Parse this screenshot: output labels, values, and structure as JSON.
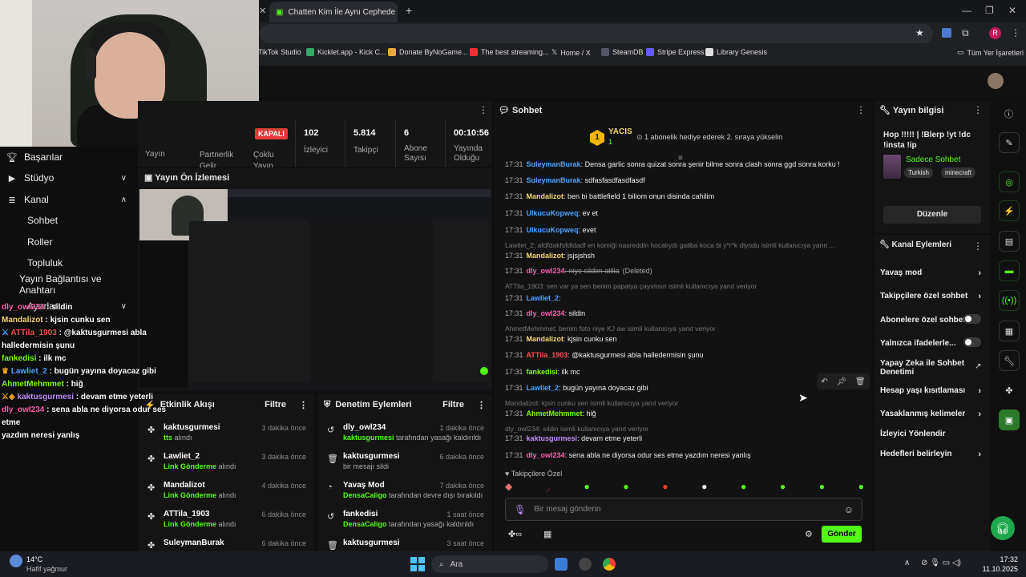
{
  "browser": {
    "tab_title": "Chatten Kim İle Aynı Cephede",
    "bookmarks": [
      "TikTok Studio",
      "Kicklet.app - Kick C...",
      "Donate ByNoGame...",
      "The best streaming...",
      "Home / X",
      "SteamDB",
      "Stripe Express",
      "Library Genesis"
    ],
    "all_bookmarks": "Tüm Yer İşaretleri",
    "profile": "R"
  },
  "sidebar": {
    "items": [
      {
        "label": "Başarılar",
        "icon": "trophy-icon"
      },
      {
        "label": "Stüdyo",
        "icon": "studio-icon",
        "chev": "∨"
      },
      {
        "label": "Kanal",
        "icon": "channel-icon",
        "chev": "∧"
      },
      {
        "label": "Sohbet"
      },
      {
        "label": "Roller"
      },
      {
        "label": "Topluluk"
      },
      {
        "label": "Yayın Bağlantısı ve Anahtarı"
      },
      {
        "label": "Ayarlar",
        "chev": "∨"
      }
    ]
  },
  "overlay_chat": [
    {
      "u": "dly_owl234",
      "c": "#ff5fae",
      "m": "sildin"
    },
    {
      "u": "Mandalizot",
      "c": "#f5d76e",
      "m": "kjsin cunku sen"
    },
    {
      "u": "ATTila_1903",
      "c": "#ff4d4d",
      "m": "@kaktusgurmesi abla",
      "m2": "halledermisin şunu"
    },
    {
      "u": "fankedisi",
      "c": "#7cfc00",
      "m": "ilk mc"
    },
    {
      "u": "Lawliet_2",
      "c": "#4da3ff",
      "m": "bugün yayına doyacaz gibi"
    },
    {
      "u": "AhmetMehmmet",
      "c": "#7cfc00",
      "m": "hiğ"
    },
    {
      "u": "kaktusgurmesi",
      "c": "#c48cff",
      "m": "devam etme yeterli"
    },
    {
      "u": "dly_owl234",
      "c": "#ff5fae",
      "m": "sena abla ne diyorsa odur ses etme",
      "m2": "yazdım neresi yanlış"
    }
  ],
  "stats": {
    "status": "KAPALI",
    "items": [
      {
        "value": "",
        "label": "Yayın"
      },
      {
        "value": "",
        "label": "Partnerlik Gelir"
      },
      {
        "value": "",
        "label": "Çoklu Yayın"
      },
      {
        "value": "102",
        "label": "İzleyici"
      },
      {
        "value": "5.814",
        "label": "Takipçi"
      },
      {
        "value": "6",
        "label": "Abone Sayısı"
      },
      {
        "value": "00:10:56",
        "label": "Yayında Olduğu"
      }
    ]
  },
  "preview": {
    "title": "Yayın Ön İzlemesi"
  },
  "activity": {
    "title": "Etkinlik Akışı",
    "filter": "Filtre",
    "events": [
      {
        "name": "kaktusgurmesi",
        "sub": "tts",
        "sub2": " alındı",
        "time": "3 dakika önce"
      },
      {
        "name": "Lawliet_2",
        "sub": "Link Gönderme",
        "sub2": " alındı",
        "time": "3 dakika önce"
      },
      {
        "name": "Mandalizot",
        "sub": "Link Gönderme",
        "sub2": " alındı",
        "time": "4 dakika önce"
      },
      {
        "name": "ATTila_1903",
        "sub": "Link Gönderme",
        "sub2": " alındı",
        "time": "6 dakika önce"
      },
      {
        "name": "SuleymanBurak",
        "sub": "",
        "sub2": "",
        "time": "6 dakika önce"
      }
    ]
  },
  "moderation": {
    "title": "Denetim Eylemleri",
    "filter": "Filtre",
    "events": [
      {
        "name": "dly_owl234",
        "sub": "kaktusgurmesi",
        "sub2": " tarafından yasağı kaldırıldı",
        "time": "1 dakika önce",
        "icon": "undo-icon"
      },
      {
        "name": "kaktusgurmesi",
        "sub": "",
        "sub2": "bir mesajı sildi",
        "time": "6 dakika önce",
        "icon": "trash-icon"
      },
      {
        "name": "Yavaş Mod",
        "sub": "DensaCaligo",
        "sub2": " tarafından devre dışı bırakıldı",
        "time": "7 dakika önce",
        "icon": "slow-icon"
      },
      {
        "name": "fankedisi",
        "sub": "DensaCaligo",
        "sub2": " tarafından yasağı kaldırıldı",
        "time": "1 saat önce",
        "icon": "undo-icon"
      },
      {
        "name": "kaktusgurmesi",
        "sub": "",
        "sub2": "",
        "time": "3 saat önce",
        "icon": "trash-icon"
      }
    ]
  },
  "chat": {
    "title": "Sohbet",
    "top_gifter": "YACIS",
    "top_gifter_count": "1",
    "gift_msg": "1 abonelik hediye ederek 2. sıraya yükselin",
    "input_placeholder": "Bir mesaj gönderin",
    "send_label": "Gönder",
    "followers_only": "Takipçilere Özel",
    "messages": [
      {
        "type": "msg",
        "t": "17:31",
        "u": "SuleymanBurak",
        "c": "#4da3ff",
        "m": ": Densa garlic sonra quizat sonra şenir bilme sonra clash sonra ggd sonra korku !"
      },
      {
        "type": "msg",
        "t": "17:31",
        "u": "SuleymanBurak",
        "c": "#4da3ff",
        "m": ": sdfasfasdfasdfasdf"
      },
      {
        "type": "msg",
        "t": "17:31",
        "u": "Mandalizot",
        "c": "#f5d76e",
        "m": ": ben bi battlefield 1 biliom onun disinda cahilim"
      },
      {
        "type": "msg",
        "t": "17:31",
        "u": "UlkucuKopweq",
        "c": "#4da3ff",
        "m": ": ev et"
      },
      {
        "type": "msg",
        "t": "17:31",
        "u": "UlkucuKopweq",
        "c": "#4da3ff",
        "m": ": evet"
      },
      {
        "type": "reply",
        "m": "Lawliet_2: afdfdakfsfdldadf en komiği nasreddin hocalıydı galiba koca bi y*r*k diyodu isimli kullanıcıya yanıt ..."
      },
      {
        "type": "msg",
        "t": "17:31",
        "u": "Mandalizot",
        "c": "#f5d76e",
        "m": ": jsjsjshsh"
      },
      {
        "type": "msg",
        "t": "17:31",
        "u": "dly_owl234",
        "c": "#ff5fae",
        "m": ": niye sildim atilla",
        "del": "(Deleted)"
      },
      {
        "type": "reply",
        "m": "ATTila_1903: sen var ya sen benim papatya çayımsın isimli kullanıcıya yanıt veriyor"
      },
      {
        "type": "msg",
        "t": "17:31",
        "u": "Lawliet_2",
        "c": "#4da3ff",
        "m": ":"
      },
      {
        "type": "msg",
        "t": "17:31",
        "u": "dly_owl234",
        "c": "#ff5fae",
        "m": ": sildin"
      },
      {
        "type": "reply",
        "m": "AhmetMehmmet: benim foto niye KJ aw isimli kullanıcıya yanıt veriyor"
      },
      {
        "type": "msg",
        "t": "17:31",
        "u": "Mandalizot",
        "c": "#f5d76e",
        "m": ": kjsin cunku sen"
      },
      {
        "type": "msg",
        "t": "17:31",
        "u": "ATTila_1903",
        "c": "#ff4d4d",
        "m": ": @kaktusgurmesi abla halledermisin şunu"
      },
      {
        "type": "msg",
        "t": "17:31",
        "u": "fankedisi",
        "c": "#7cfc00",
        "m": ": ilk mc"
      },
      {
        "type": "msg",
        "t": "17:31",
        "u": "Lawliet_2",
        "c": "#4da3ff",
        "m": ": bugün yayına doyacaz gibi"
      },
      {
        "type": "reply",
        "m": "Mandalizot: kjsin cunku sen isimli kullanıcıya yanıt veriyor"
      },
      {
        "type": "msg",
        "t": "17:31",
        "u": "AhmetMehmmet",
        "c": "#7cfc00",
        "m": ": hiğ"
      },
      {
        "type": "reply",
        "m": "dly_owl234: sildin isimli kullanıcıya yanıt veriyor"
      },
      {
        "type": "msg",
        "t": "17:31",
        "u": "kaktusgurmesi",
        "c": "#c48cff",
        "m": ": devam etme yeterli"
      },
      {
        "type": "msg",
        "t": "17:31",
        "u": "dly_owl234",
        "c": "#ff5fae",
        "m": ": sena abla ne diyorsa odur ses etme yazdım neresi yanlış"
      }
    ]
  },
  "stream_info": {
    "title": "Yayın bilgisi",
    "stream_title": "Hop !!!!! | !Blerp !yt !dc !insta !ip",
    "category": "Sadece Sohbet",
    "tags": [
      "Turkish",
      "minecraft"
    ],
    "edit_label": "Düzenle"
  },
  "channel_actions": {
    "title": "Kanal Eylemleri",
    "items": [
      {
        "label": "Yavaş mod",
        "kind": "arrow"
      },
      {
        "label": "Takipçilere özel sohbet",
        "kind": "arrow"
      },
      {
        "label": "Abonelere özel sohbet",
        "kind": "toggle"
      },
      {
        "label": "Yalnızca ifadelerle...",
        "kind": "toggle"
      },
      {
        "label": "Yapay Zeka ile Sohbet Denetimi",
        "kind": "ext"
      },
      {
        "label": "Hesap yaşı kısıtlaması",
        "kind": "arrow"
      },
      {
        "label": "Yasaklanmış kelimeler",
        "kind": "arrow"
      },
      {
        "label": "İzleyici Yönlendir",
        "kind": "none"
      },
      {
        "label": "Hedefleri belirleyin",
        "kind": "arrow"
      }
    ]
  },
  "taskbar": {
    "weather_temp": "14°C",
    "weather_desc": "Hafif yağmur",
    "search": "Ara",
    "time": "17:32",
    "date": "11.10.2025"
  }
}
